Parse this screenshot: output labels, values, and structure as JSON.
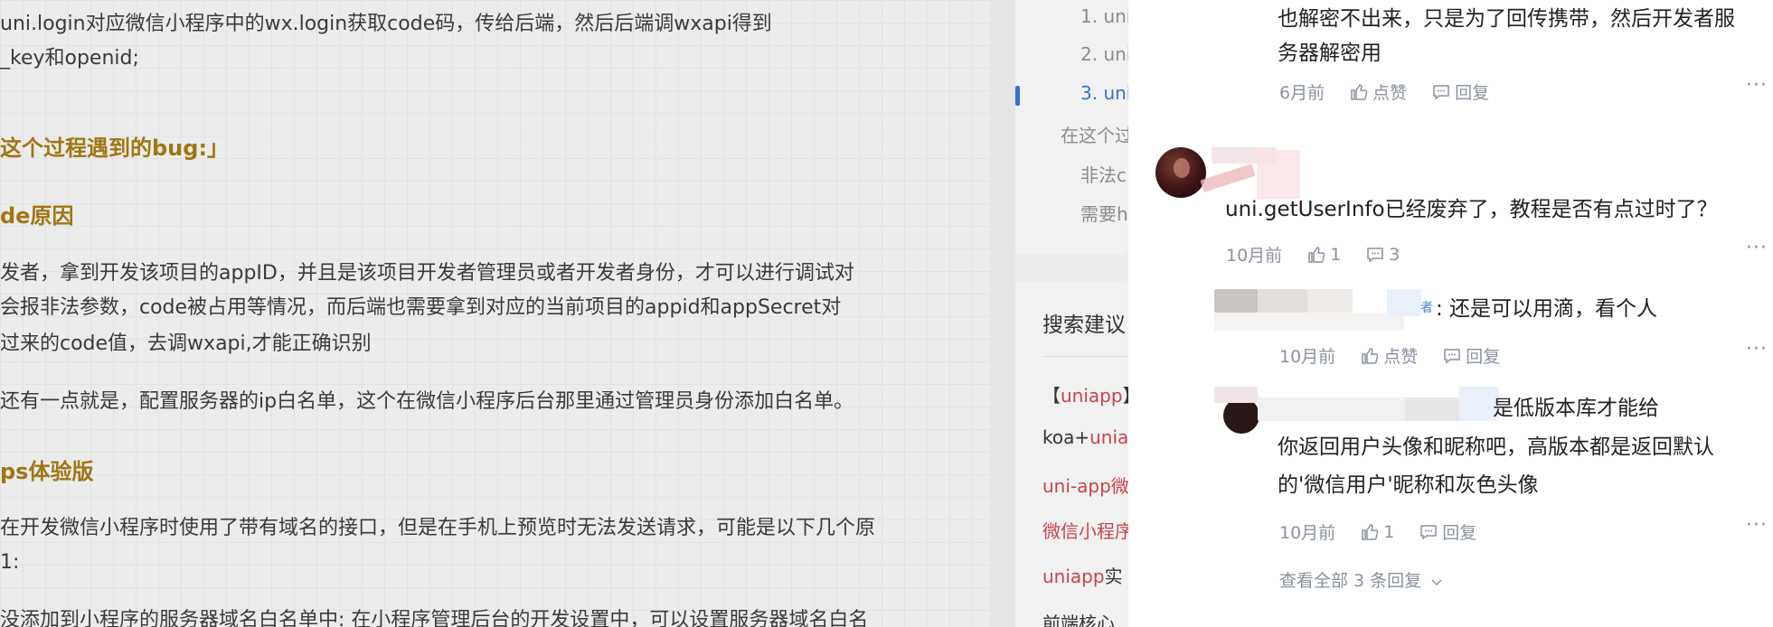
{
  "article": {
    "lines": [
      "uni.login对应微信小程序中的wx.login获取code码，传给后端，然后后端调wxapi得到",
      "_key和openid;",
      "这个过程遇到的bug:」",
      "de原因",
      "发者，拿到开发该项目的appID，并且是该项目开发者管理员或者开发者身份，才可以进行调试对",
      "会报非法参数，code被占用等情况，而后端也需要拿到对应的当前项目的appid和appSecret对",
      "过来的code值，去调wxapi,才能正确识别",
      "还有一点就是，配置服务器的ip白名单，这个在微信小程序后台那里通过管理员身份添加白名单。",
      "ps体验版",
      "在开发微信小程序时使用了带有域名的接口，但是在手机上预览时无法发送请求，可能是以下几个原",
      "1:",
      "没添加到小程序的服务器域名白名单中: 在小程序管理后台的开发设置中，可以设置服务器域名白名"
    ]
  },
  "toc": {
    "items": [
      "1. uni",
      "2. uni",
      "3. uni",
      "在这个过",
      "非法c",
      "需要h"
    ]
  },
  "search": {
    "title": "搜索建议",
    "items": [
      {
        "prefix": "【",
        "highlight": "uniapp",
        "suffix": "】"
      },
      {
        "prefix": "koa+",
        "highlight": "unia",
        "suffix": ""
      },
      {
        "prefix": "",
        "highlight": "uni-app",
        "suffix": "微"
      },
      {
        "prefix": "",
        "highlight": "微信小程序",
        "suffix": ""
      },
      {
        "prefix": "",
        "highlight": "uniapp",
        "suffix": "实"
      },
      {
        "prefix": "前端核心",
        "highlight": "",
        "suffix": ""
      }
    ]
  },
  "comments": {
    "c0": {
      "lines": [
        "也解密不出来，只是为了回传携带，然后开发者服",
        "务器解密用"
      ],
      "time": "6月前",
      "like": "点赞",
      "reply": "回复"
    },
    "c1": {
      "text": "uni.getUserInfo已经废弃了，教程是否有点过时了？",
      "time": "10月前",
      "like_count": "1",
      "reply_count": "3"
    },
    "r1": {
      "author_tag": "者",
      "text": ": 还是可以用滴，看个人",
      "time": "10月前",
      "like": "点赞",
      "reply": "回复"
    },
    "r2": {
      "lines": [
        "是低版本库才能给",
        "你返回用户头像和昵称吧，高版本都是返回默认",
        "的'微信用户'昵称和灰色头像"
      ],
      "time": "10月前",
      "like_count": "1",
      "reply": "回复"
    },
    "view_all": "查看全部 3 条回复",
    "more": "···"
  },
  "colors": {
    "link_blue": "#3c6fd0",
    "heading_gold": "#a07614",
    "search_red": "#c7444a",
    "meta_gray": "#8a919f"
  }
}
